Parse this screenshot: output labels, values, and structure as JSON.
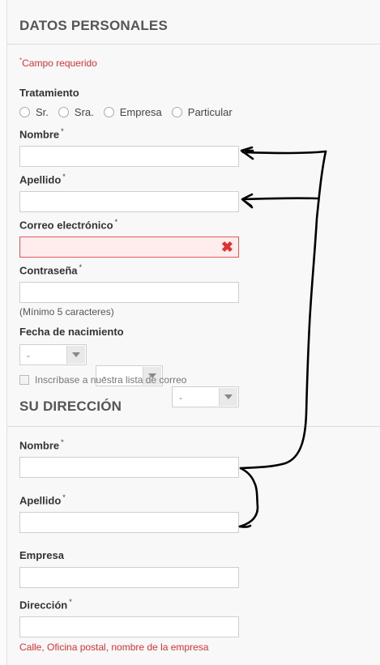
{
  "personal": {
    "title": "DATOS PERSONALES",
    "required_mark": "*",
    "required_note": "Campo requerido",
    "salutation_label": "Tratamiento",
    "salutation_options": [
      "Sr.",
      "Sra.",
      "Empresa",
      "Particular"
    ],
    "first_name_label": "Nombre",
    "last_name_label": "Apellido",
    "email_label": "Correo electrónico",
    "password_label": "Contraseña",
    "password_hint": "(Mínimo 5 caracteres)",
    "birth_label": "Fecha de nacimiento",
    "birth_day": "-",
    "birth_month": "-",
    "birth_year": "-",
    "newsletter_label": "Inscríbase a nuestra lista de correo",
    "error_icon": "✖"
  },
  "address": {
    "title": "SU DIRECCIÓN",
    "first_name_label": "Nombre",
    "last_name_label": "Apellido",
    "company_label": "Empresa",
    "address_label": "Dirección",
    "address_hint": "Calle, Oficina postal, nombre de la empresa"
  },
  "colors": {
    "error": "#e03030",
    "required": "#dd3333",
    "annotation": "#000000"
  }
}
